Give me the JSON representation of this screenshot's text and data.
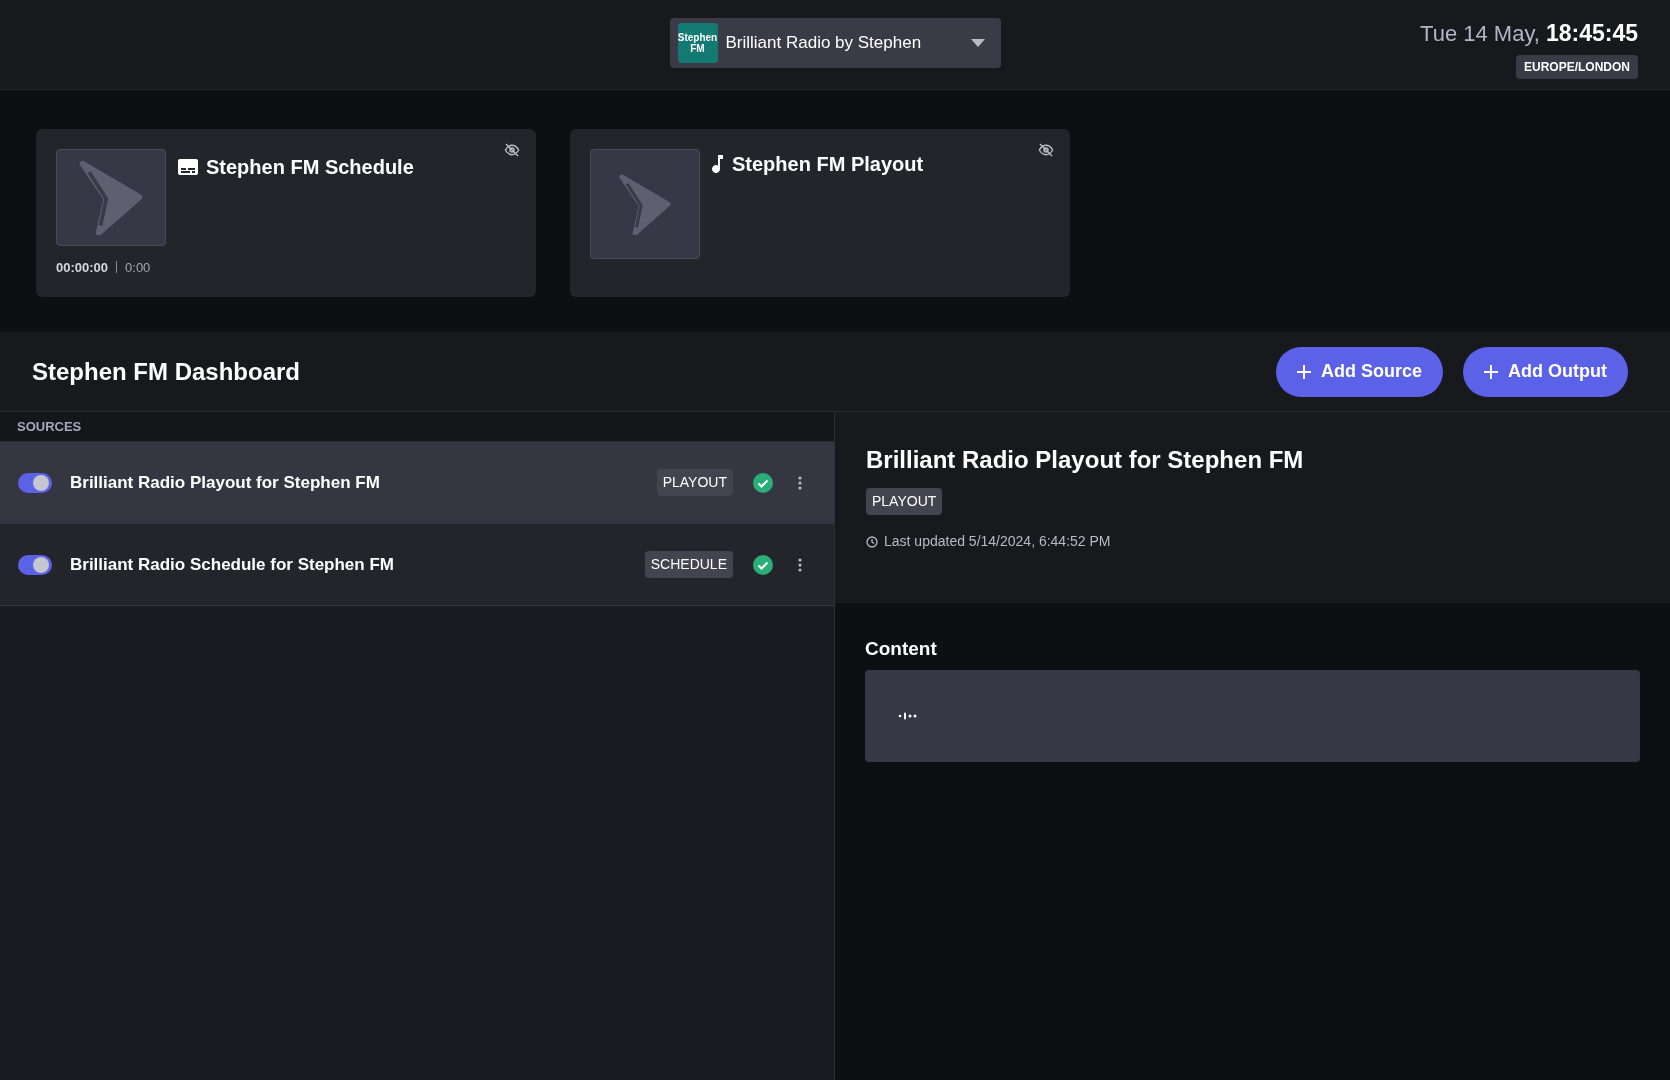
{
  "header": {
    "station": {
      "logo": "Stephen FM",
      "name": "Brilliant Radio by Stephen"
    },
    "date": "Tue 14 May,",
    "time": "18:45:45",
    "timezone": "EUROPE/LONDON"
  },
  "players": [
    {
      "kind": "schedule",
      "title": "Stephen FM Schedule",
      "elapsed": "00:00:00",
      "duration": "0:00"
    },
    {
      "kind": "playout",
      "title": "Stephen FM Playout"
    }
  ],
  "dashboard": {
    "title": "Stephen FM Dashboard",
    "buttons": [
      "Add Source",
      "Add Output"
    ]
  },
  "sources": {
    "heading": "SOURCES",
    "items": [
      {
        "name": "Brilliant Radio Playout for Stephen FM",
        "tag": "PLAYOUT",
        "on": true,
        "selected": true
      },
      {
        "name": "Brilliant Radio Schedule for Stephen FM",
        "tag": "SCHEDULE",
        "on": true,
        "selected": false
      }
    ]
  },
  "detail": {
    "title": "Brilliant Radio Playout for Stephen FM",
    "tag": "PLAYOUT",
    "updated": "Last updated 5/14/2024, 6:44:52 PM",
    "content_heading": "Content"
  }
}
